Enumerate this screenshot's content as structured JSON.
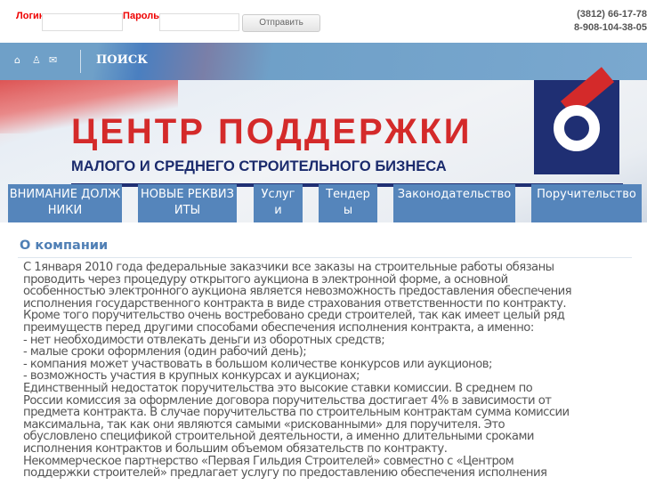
{
  "login": {
    "login_label": "Логин",
    "password_label": "Пароль",
    "submit_label": "Отправить"
  },
  "contacts": {
    "phone1": "(3812) 66-17-78",
    "phone2": "8-908-104-38-05"
  },
  "nav": {
    "search_label": "ПОИСК",
    "icons": [
      "home-icon",
      "sitemap-icon",
      "mail-icon"
    ]
  },
  "banner": {
    "title": "ЦЕНТР ПОДДЕРЖКИ",
    "subtitle": "МАЛОГО И СРЕДНЕГО СТРОИТЕЛЬНОГО БИЗНЕСА"
  },
  "menu": [
    {
      "label": "ВНИМАНИЕ ДОЛЖНИКИ"
    },
    {
      "label": "НОВЫЕ РЕКВИЗИТЫ"
    },
    {
      "label": "Услуги"
    },
    {
      "label": "Тендеры"
    },
    {
      "label": "Законодательство"
    },
    {
      "label": "Поручительство"
    }
  ],
  "content": {
    "title": "О компании",
    "lines": [
      "С 1января 2010 года федеральные заказчики все заказы на строительные работы обязаны",
      "проводить через процедуру открытого аукциона в электронной форме, а основной",
      "особенностью электронного аукциона является невозможность предоставления обеспечения",
      "исполнения государственного контракта в виде страхования ответственности по контракту.",
      "Кроме того поручительство очень востребовано среди строителей, так как имеет целый ряд",
      "преимуществ перед другими способами обеспечения исполнения контракта, а именно:",
      "- нет необходимости отвлекать деньги из оборотных средств;",
      "- малые сроки оформления (один рабочий день);",
      "- компания может участвовать в большом количестве конкурсов или аукционов;",
      "- возможность участия в крупных конкурсах и аукционах;",
      "Единственный недостаток поручительства это высокие ставки комиссии. В среднем по",
      "России комиссия за оформление договора поручительства достигает 4% в зависимости от",
      "предмета контракта. В случае поручительства по строительным контрактам сумма комиссии",
      "максимальна, так как они являются самыми «рискованными» для поручителя. Это",
      "обусловлено спецификой строительной деятельности, а именно длительными сроками",
      "исполнения контрактов и большим объемом обязательств по контракту.",
      "Некоммерческое партнерство «Первая Гильдия Строителей» совместно с «Центром",
      "поддержки строителей» предлагает услугу по предоставлению обеспечения исполнения"
    ]
  }
}
